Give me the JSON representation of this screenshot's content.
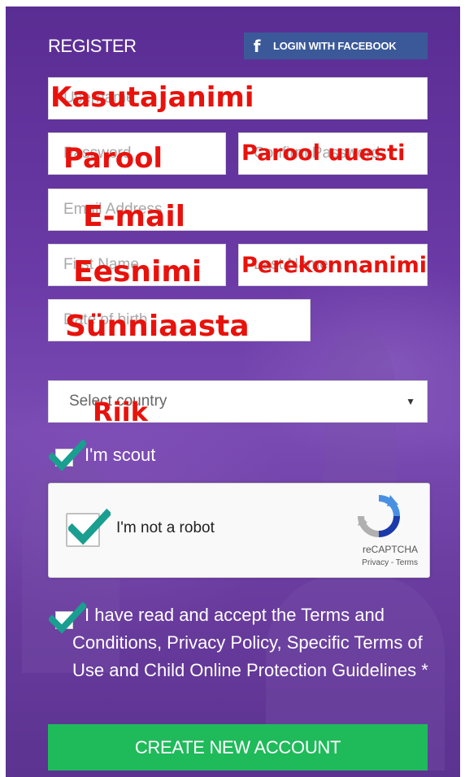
{
  "header": {
    "title": "REGISTER",
    "facebook_label": "LOGIN WITH FACEBOOK",
    "facebook_icon": "f"
  },
  "fields": {
    "username": {
      "placeholder": "Username",
      "overlay": "Kasutajanimi"
    },
    "password": {
      "placeholder": "Password",
      "overlay": "Parool"
    },
    "confirm_password": {
      "placeholder": "Confirm Password",
      "overlay": "Parool uuesti"
    },
    "email": {
      "placeholder": "Email Address",
      "overlay": "E-mail"
    },
    "first_name": {
      "placeholder": "First Name",
      "overlay": "Eesnimi"
    },
    "last_name": {
      "placeholder": "Last Name",
      "overlay": "Perekonnanimi"
    },
    "birth": {
      "placeholder": "Date of birth",
      "overlay": "Sünniaasta"
    }
  },
  "country": {
    "selected": "Select country",
    "overlay": "Riik",
    "arrow": "▼"
  },
  "scout": {
    "label": "I'm scout",
    "checked": true
  },
  "recaptcha": {
    "label": "I'm not a robot",
    "brand": "reCAPTCHA",
    "links": "Privacy - Terms",
    "checked": true
  },
  "terms": {
    "text": "I have read and accept the Terms and Conditions, Privacy Policy, Specific Terms of Use and Child Online Protection Guidelines *",
    "checked": true
  },
  "submit": {
    "label": "CREATE NEW ACCOUNT"
  },
  "colors": {
    "facebook": "#3b5998",
    "submit": "#1fba5a",
    "overlay_red": "#e8120c",
    "tick": "#1a9e8f"
  }
}
